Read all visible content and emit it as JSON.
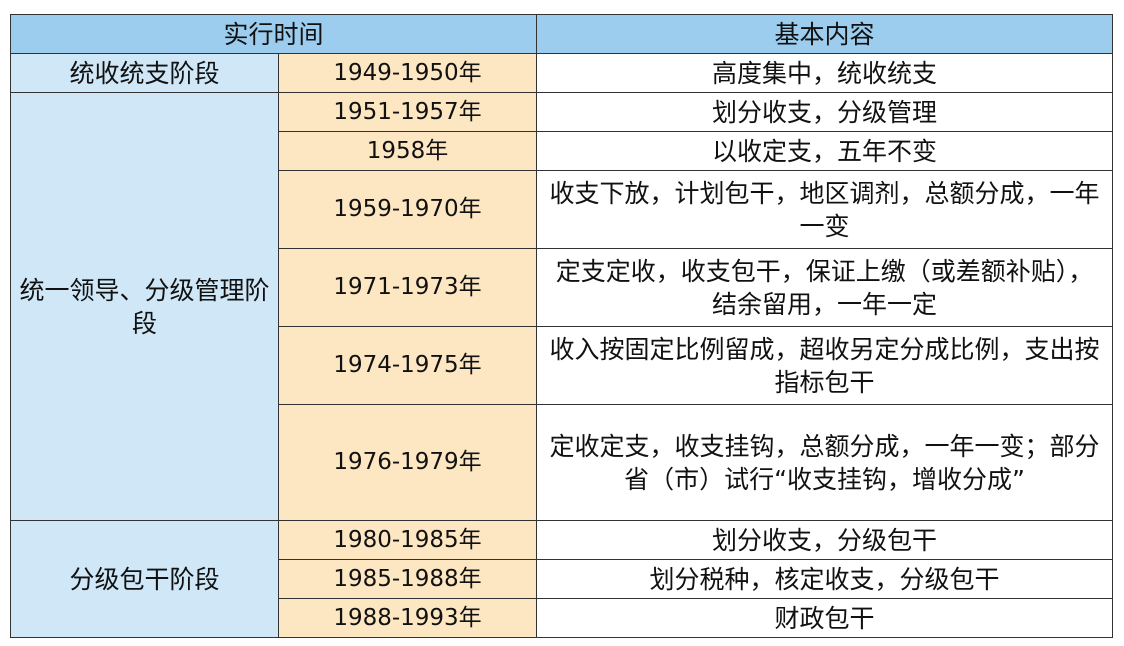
{
  "table": {
    "headers": {
      "time": "实行时间",
      "content": "基本内容"
    },
    "stages": [
      "统收统支阶段",
      "统一领导、分级管理阶段",
      "分级包干阶段"
    ],
    "rows": [
      {
        "period": "1949-1950年",
        "content": "高度集中，统收统支"
      },
      {
        "period": "1951-1957年",
        "content": "划分收支，分级管理"
      },
      {
        "period": "1958年",
        "content": "以收定支，五年不变"
      },
      {
        "period": "1959-1970年",
        "content": "收支下放，计划包干，地区调剂，总额分成，一年一变"
      },
      {
        "period": "1971-1973年",
        "content": "定支定收，收支包干，保证上缴（或差额补贴），结余留用，一年一定"
      },
      {
        "period": "1974-1975年",
        "content": "收入按固定比例留成，超收另定分成比例，支出按指标包干"
      },
      {
        "period": "1976-1979年",
        "content": "定收定支，收支挂钩，总额分成，一年一变；部分省（市）试行“收支挂钩，增收分成”"
      },
      {
        "period": "1980-1985年",
        "content": "划分收支，分级包干"
      },
      {
        "period": "1985-1988年",
        "content": "划分税种，核定收支，分级包干"
      },
      {
        "period": "1988-1993年",
        "content": "财政包干"
      }
    ]
  }
}
